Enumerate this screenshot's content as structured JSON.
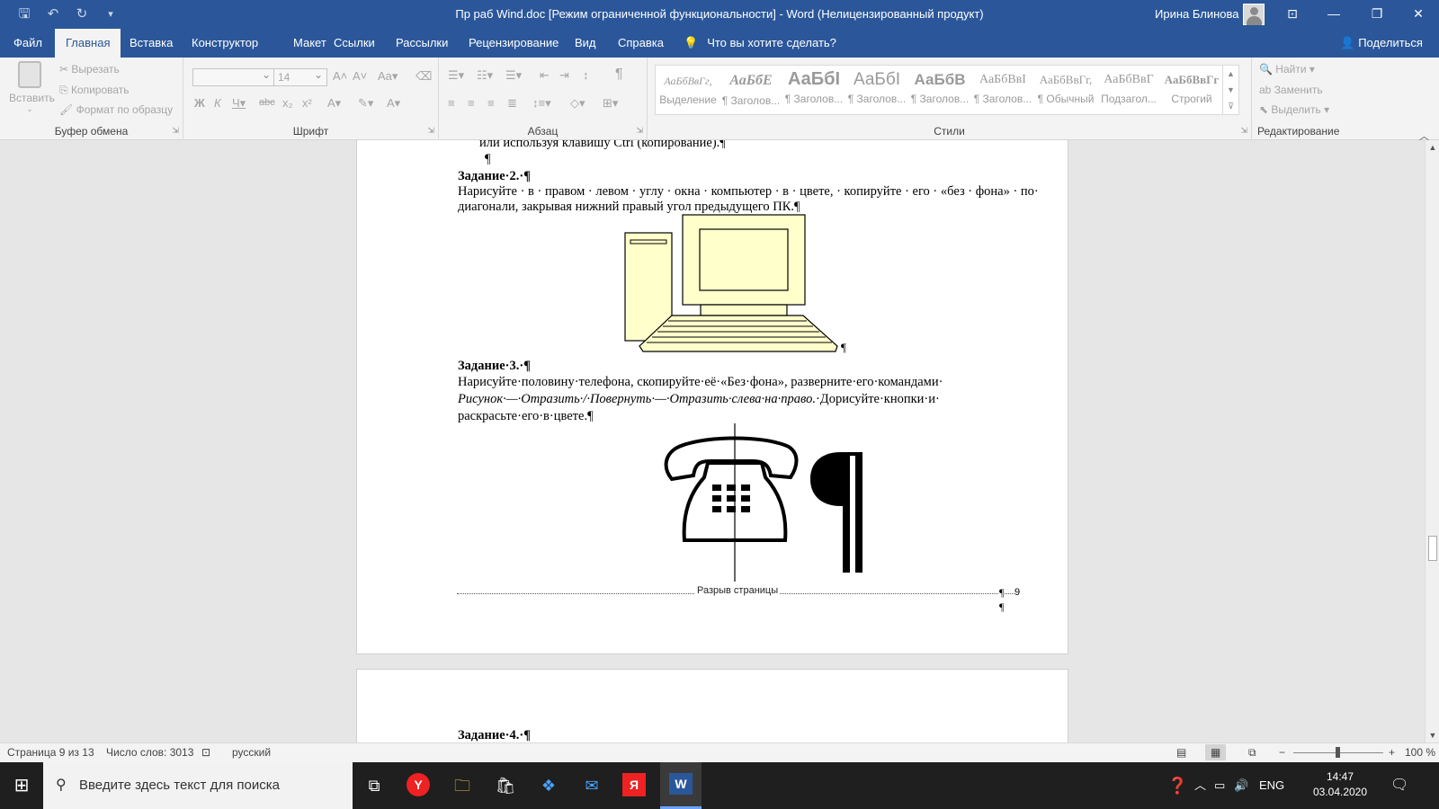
{
  "window": {
    "title": "Пр раб Wind.doc [Режим ограниченной функциональности]  -  Word (Нелицензированный продукт)",
    "user": "Ирина Блинова"
  },
  "tabs": [
    "Файл",
    "Главная",
    "Вставка",
    "Конструктор",
    "Макет",
    "Ссылки",
    "Рассылки",
    "Рецензирование",
    "Вид",
    "Справка"
  ],
  "tell_me": "Что вы хотите сделать?",
  "share": "Поделиться",
  "ribbon": {
    "clipboard": {
      "paste": "Вставить",
      "cut": "Вырезать",
      "copy": "Копировать",
      "format_painter": "Формат по образцу",
      "label": "Буфер обмена"
    },
    "font": {
      "size": "14",
      "label": "Шрифт"
    },
    "paragraph": {
      "label": "Абзац"
    },
    "styles": {
      "label": "Стили",
      "items": [
        {
          "sample": "АаБбВвГг,",
          "name": "Выделение"
        },
        {
          "sample": "АаБбЕ",
          "name": "¶ Заголов..."
        },
        {
          "sample": "АаБбI",
          "name": "¶ Заголов..."
        },
        {
          "sample": "АаБбI",
          "name": "¶ Заголов..."
        },
        {
          "sample": "АаБбВ",
          "name": "¶ Заголов..."
        },
        {
          "sample": "АаБбВвІ",
          "name": "¶ Заголов..."
        },
        {
          "sample": "АаБбВвГг,",
          "name": "¶ Обычный"
        },
        {
          "sample": "АаБбВвГ",
          "name": "Подзагол..."
        },
        {
          "sample": "АаБбВвГг",
          "name": "Строгий"
        }
      ]
    },
    "editing": {
      "find": "Найти",
      "replace": "Заменить",
      "select": "Выделить",
      "label": "Редактирование"
    }
  },
  "document": {
    "line_top": "или используя клавишу Ctrl (копирование).¶",
    "empty_para": "¶",
    "task2_title": "Задание·2.·¶",
    "task2_line1": "Нарисуйте · в · правом · левом · углу · окна · компьютер · в · цвете, · копируйте · его · «без · фона» · по·",
    "task2_line2": "диагонали, закрывая нижний правый угол предыдущего ПК.¶",
    "pc_mark": "¶",
    "task3_title": "Задание·3.·¶",
    "task3_line1": "Нарисуйте·половину·телефона, скопируйте·её·«Без·фона», разверните·его·командами·",
    "task3_line2_italic": "Рисунок·—·Отразить·/·Повернуть·—·Отразить·слева·на·право.",
    "task3_line2_rest": "·Дорисуйте·кнопки·и·",
    "task3_line3": "раскрасьте·его·в·цвете.¶",
    "page_break": "Разрыв страницы",
    "pb_mark": "¶",
    "page_num": "9",
    "after_break_mark": "¶",
    "task4_title": "Задание·4.·¶"
  },
  "status": {
    "page": "Страница 9 из 13",
    "words": "Число слов: 3013",
    "language": "русский",
    "zoom": "100 %"
  },
  "taskbar": {
    "search_placeholder": "Введите здесь текст для поиска",
    "lang": "ENG",
    "time": "14:47",
    "date": "03.04.2020"
  },
  "colors": {
    "word_blue": "#2b579a",
    "pc_fill": "#ffffcc"
  }
}
